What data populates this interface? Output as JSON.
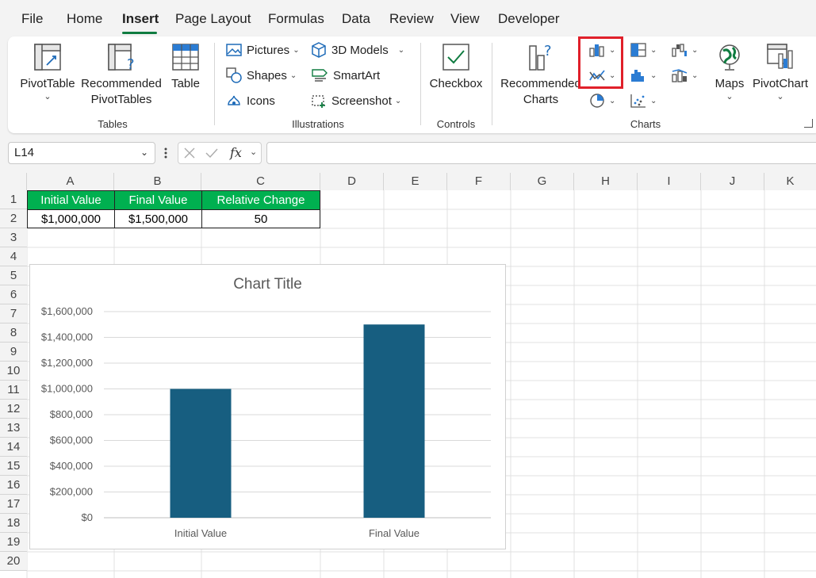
{
  "menu": {
    "tabs": [
      "File",
      "Home",
      "Insert",
      "Page Layout",
      "Formulas",
      "Data",
      "Review",
      "View",
      "Developer"
    ],
    "active": "Insert"
  },
  "ribbon": {
    "tables": {
      "pivottable": "PivotTable",
      "recommended_pivottables_line1": "Recommended",
      "recommended_pivottables_line2": "PivotTables",
      "table": "Table",
      "label": "Tables"
    },
    "illustrations": {
      "pictures": "Pictures",
      "shapes": "Shapes",
      "icons": "Icons",
      "models3d": "3D Models",
      "smartart": "SmartArt",
      "screenshot": "Screenshot",
      "label": "Illustrations"
    },
    "controls": {
      "checkbox": "Checkbox",
      "label": "Controls"
    },
    "charts": {
      "recommended_line1": "Recommended",
      "recommended_line2": "Charts",
      "maps": "Maps",
      "pivotchart": "PivotChart",
      "label": "Charts"
    }
  },
  "formula_bar": {
    "name_box": "L14",
    "fx": "fx",
    "formula": ""
  },
  "sheet": {
    "columns": [
      "A",
      "B",
      "C",
      "D",
      "E",
      "F",
      "G",
      "H",
      "I",
      "J",
      "K"
    ],
    "rows": [
      "1",
      "2",
      "3",
      "4",
      "5",
      "6",
      "7",
      "8",
      "9",
      "10",
      "11",
      "12",
      "13",
      "14",
      "15",
      "16",
      "17",
      "18",
      "19",
      "20"
    ],
    "headers": [
      "Initial Value",
      "Final Value",
      "Relative Change"
    ],
    "values": [
      "$1,000,000",
      "$1,500,000",
      "50"
    ]
  },
  "colors": {
    "header_green": "#00b050",
    "bar": "#175e80",
    "accent": "#107c41",
    "highlight": "#e0202a"
  },
  "chart_data": {
    "type": "bar",
    "title": "Chart Title",
    "categories": [
      "Initial Value",
      "Final Value"
    ],
    "values": [
      1000000,
      1500000
    ],
    "ylim": [
      0,
      1600000
    ],
    "yticks": [
      "$0",
      "$200,000",
      "$400,000",
      "$600,000",
      "$800,000",
      "$1,000,000",
      "$1,200,000",
      "$1,400,000",
      "$1,600,000"
    ],
    "grid": true,
    "color": "#175e80"
  }
}
